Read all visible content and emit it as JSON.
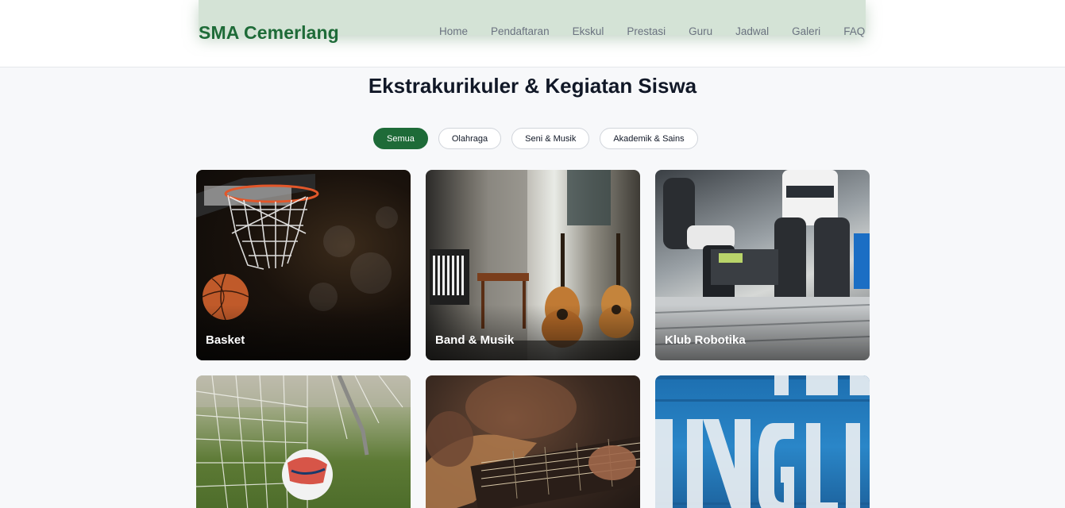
{
  "header": {
    "brand": "SMA Cemerlang",
    "nav": [
      "Home",
      "Pendaftaran",
      "Ekskul",
      "Prestasi",
      "Guru",
      "Jadwal",
      "Galeri",
      "FAQ"
    ]
  },
  "main": {
    "title": "Ekstrakurikuler & Kegiatan Siswa",
    "filters": [
      {
        "label": "Semua",
        "active": true
      },
      {
        "label": "Olahraga",
        "active": false
      },
      {
        "label": "Seni & Musik",
        "active": false
      },
      {
        "label": "Akademik & Sains",
        "active": false
      }
    ],
    "cards": [
      {
        "title": "Basket",
        "image": "basketball-hoop"
      },
      {
        "title": "Band & Musik",
        "image": "guitars-room"
      },
      {
        "title": "Klub Robotika",
        "image": "robot-arms"
      },
      {
        "title": "",
        "image": "football-net"
      },
      {
        "title": "",
        "image": "guitar-playing"
      },
      {
        "title": "",
        "image": "english-sign"
      }
    ]
  },
  "colors": {
    "brand": "#1e6b38",
    "background": "#f7f8fa"
  }
}
